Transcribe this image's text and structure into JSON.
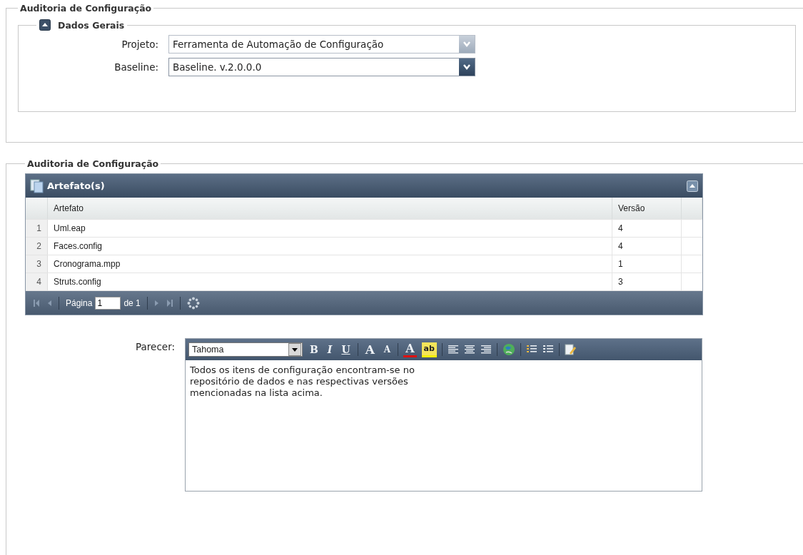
{
  "sections": [
    {
      "title": "Auditoria de Configuração"
    },
    {
      "title": "Auditoria de Configuração"
    }
  ],
  "general": {
    "title": "Dados Gerais",
    "expanded": true,
    "fields": [
      {
        "label": "Projeto:",
        "value": "Ferramenta de Automação de Configuração",
        "disabled": true
      },
      {
        "label": "Baseline:",
        "value": "Baseline. v.2.0.0.0",
        "disabled": false
      }
    ]
  },
  "grid": {
    "title": "Artefato(s)",
    "expanded": true,
    "columns": [
      "Artefato",
      "Versão"
    ],
    "rows": [
      {
        "num": "1",
        "artefato": "Uml.eap",
        "versao": "4"
      },
      {
        "num": "2",
        "artefato": "Faces.config",
        "versao": "4"
      },
      {
        "num": "3",
        "artefato": "Cronograma.mpp",
        "versao": "1"
      },
      {
        "num": "4",
        "artefato": "Struts.config",
        "versao": "3"
      }
    ],
    "pager": {
      "page_label": "Página",
      "page": "1",
      "of_label": "de 1"
    }
  },
  "opinion": {
    "label": "Parecer:",
    "font": "Tahoma",
    "toolbar": [
      {
        "kind": "bold",
        "text": "B"
      },
      {
        "kind": "italic",
        "text": "I"
      },
      {
        "kind": "underline",
        "text": "U"
      },
      {
        "kind": "sep"
      },
      {
        "kind": "grow",
        "text": "A"
      },
      {
        "kind": "shrink",
        "text": "A"
      },
      {
        "kind": "sep"
      },
      {
        "kind": "color",
        "text": "A"
      },
      {
        "kind": "highlight",
        "text": "ab"
      },
      {
        "kind": "sep"
      },
      {
        "kind": "left"
      },
      {
        "kind": "center"
      },
      {
        "kind": "right"
      },
      {
        "kind": "sep"
      },
      {
        "kind": "link"
      },
      {
        "kind": "sep"
      },
      {
        "kind": "ordered"
      },
      {
        "kind": "bullet"
      },
      {
        "kind": "sep"
      },
      {
        "kind": "source"
      }
    ],
    "text": "Todos os itens de configuração encontram-se no\nrepositório de dados e nas respectivas versões\nmencionadas na lista acima."
  }
}
